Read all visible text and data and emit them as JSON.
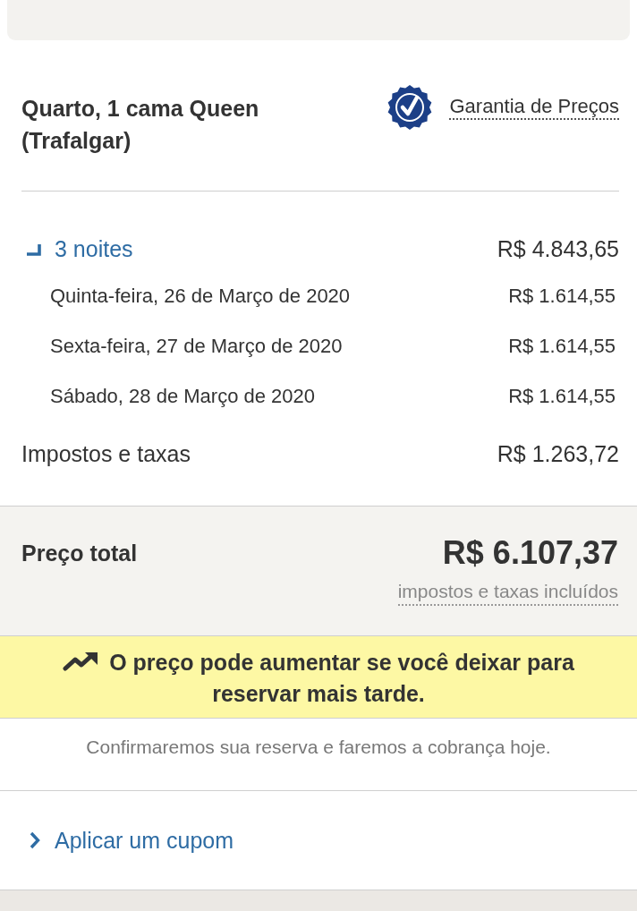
{
  "room": {
    "title": "Quarto, 1 cama Queen (Trafalgar)",
    "price_guarantee": "Garantia de Preços"
  },
  "stay": {
    "label": "3 noites",
    "expanded": true,
    "amount": "R$ 4.843,65",
    "nights": [
      {
        "date": "Quinta-feira, 26 de Março de 2020",
        "amount": "R$ 1.614,55"
      },
      {
        "date": "Sexta-feira, 27 de Março de 2020",
        "amount": "R$ 1.614,55"
      },
      {
        "date": "Sábado, 28 de Março de 2020",
        "amount": "R$ 1.614,55"
      }
    ]
  },
  "taxes": {
    "label": "Impostos e taxas",
    "amount": "R$ 1.263,72"
  },
  "total": {
    "label": "Preço total",
    "amount": "R$ 6.107,37",
    "note": "impostos e taxas incluídos"
  },
  "alert": {
    "message": "O preço pode aumentar se você deixar para reservar mais tarde."
  },
  "notice": "Confirmaremos sua reserva e faremos a cobrança hoje.",
  "coupon": {
    "label": "Aplicar um cupom",
    "expanded": false
  }
}
